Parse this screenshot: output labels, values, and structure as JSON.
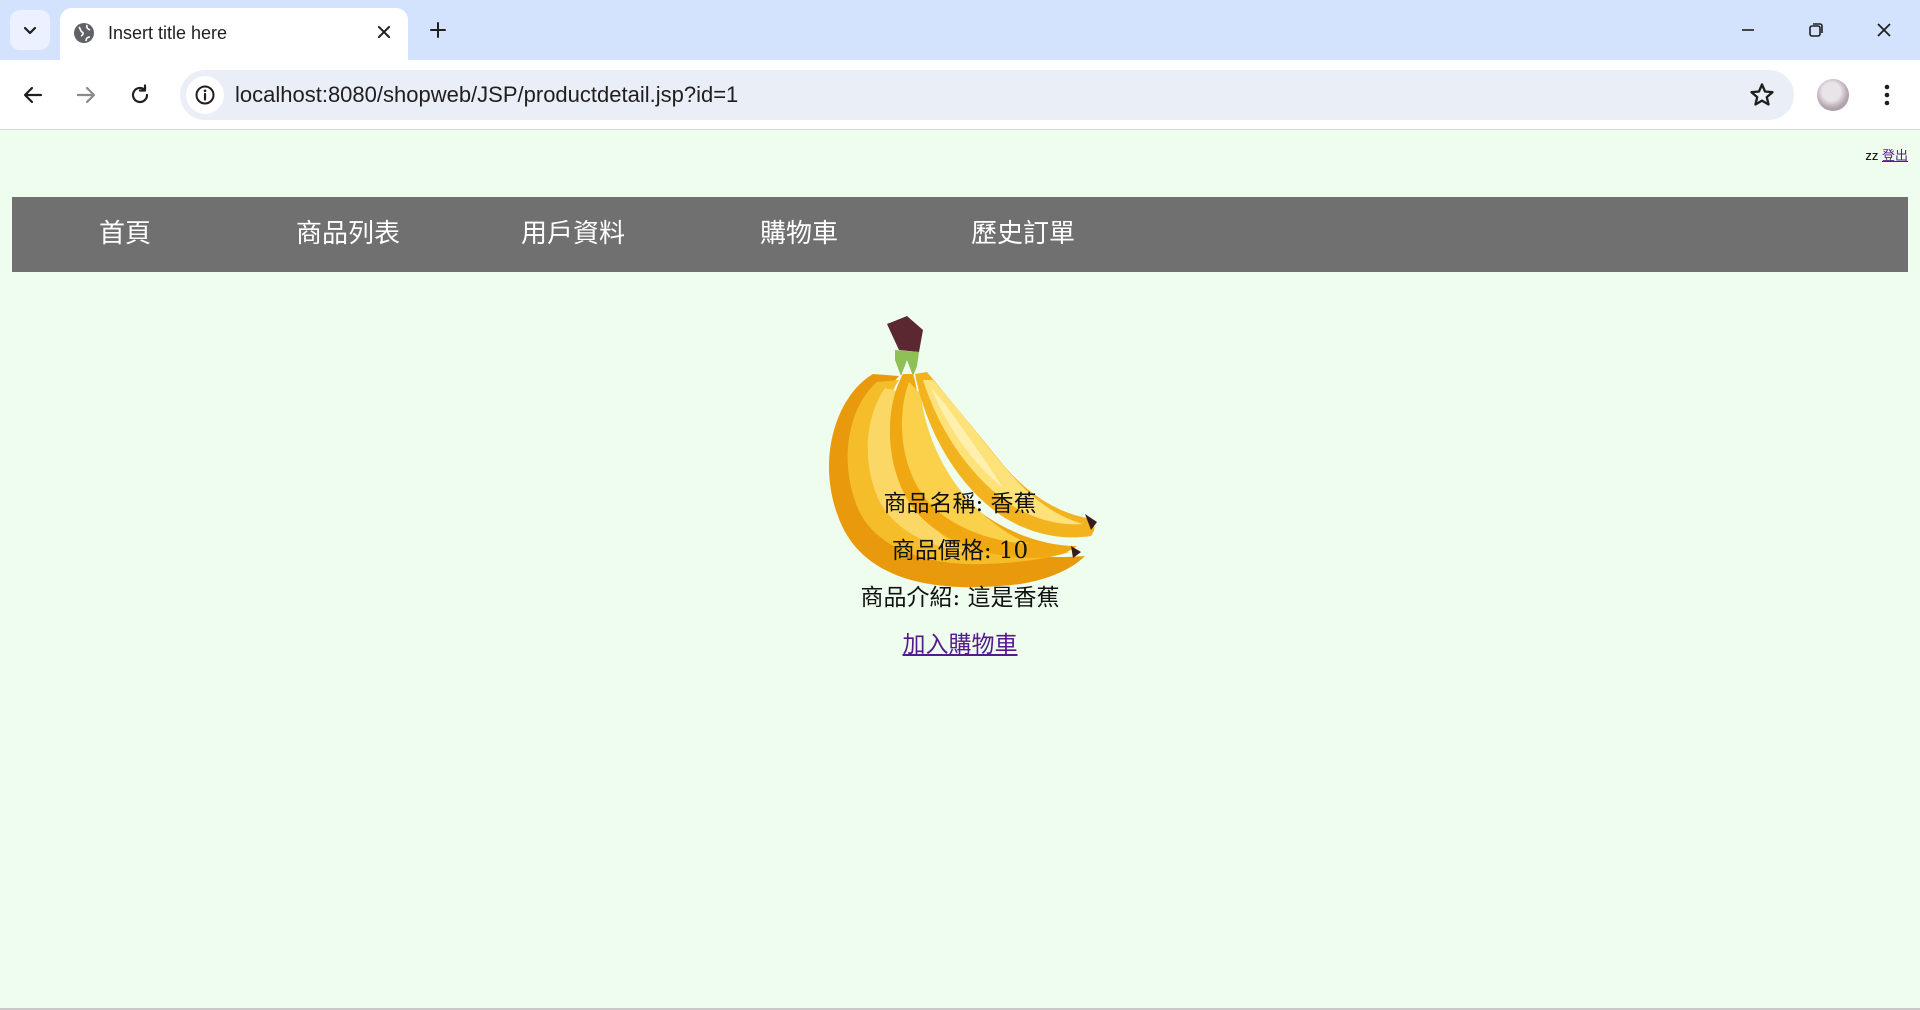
{
  "browser": {
    "tab_title": "Insert title here",
    "url": "localhost:8080/shopweb/JSP/productdetail.jsp?id=1"
  },
  "user": {
    "name": "zz",
    "logout_label": "登出"
  },
  "nav": {
    "items": [
      {
        "label": "首頁"
      },
      {
        "label": "商品列表"
      },
      {
        "label": "用戶資料"
      },
      {
        "label": "購物車"
      },
      {
        "label": "歷史訂單"
      }
    ]
  },
  "product": {
    "name_line": "商品名稱: 香蕉",
    "price_line": "商品價格: 10",
    "desc_line": "商品介紹: 這是香蕉",
    "add_to_cart_label": "加入購物車"
  },
  "colors": {
    "page_bg": "#eefdee",
    "navbar_bg": "#707070",
    "tabbar_bg": "#d3e3fd",
    "link": "#551a8b"
  }
}
